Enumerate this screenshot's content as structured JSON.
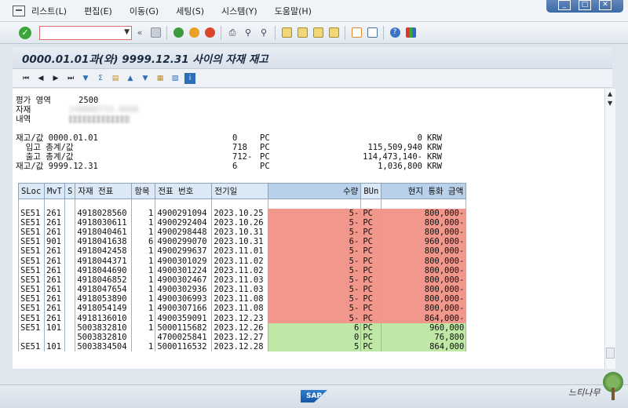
{
  "menu": {
    "items": [
      "리스트(L)",
      "편집(E)",
      "이동(G)",
      "세팅(S)",
      "시스템(Y)",
      "도움말(H)"
    ]
  },
  "window_controls": [
    "_",
    "□",
    "✕"
  ],
  "toolbar": {
    "command_value": ""
  },
  "title": "0000.01.01과(와) 9999.12.31 사이의 자재 재고",
  "header": {
    "area_label": "평가 영역",
    "area_value": "2500",
    "material_label": "자재",
    "material_value": "240000715.0000",
    "desc_label": "내역"
  },
  "summary": [
    {
      "label": "재고/값 0000.01.01",
      "qty": "0",
      "unit": "PC",
      "amount": "0",
      "currency": "KRW"
    },
    {
      "label": "  입고 총계/값",
      "qty": "718",
      "unit": "PC",
      "amount": "115,509,940",
      "currency": "KRW"
    },
    {
      "label": "  출고 총계/값",
      "qty": "712-",
      "unit": "PC",
      "amount": "114,473,140-",
      "currency": "KRW"
    },
    {
      "label": "재고/값 9999.12.31",
      "qty": "6",
      "unit": "PC",
      "amount": "1,036,800",
      "currency": "KRW"
    }
  ],
  "table": {
    "columns": [
      "SLoc",
      "MvT",
      "S",
      "자재 전표",
      "항목",
      "전표 번호",
      "전기일",
      "수량",
      "BUn",
      "현지 통화 금액"
    ],
    "rows": [
      {
        "sloc": "SE51",
        "mvt": "261",
        "s": "",
        "doc": "4918028560",
        "item": "1",
        "ref": "4900291094",
        "date": "2023.10.25",
        "qty": "5-",
        "bun": "PC",
        "amt": "800,000-",
        "type": "neg"
      },
      {
        "sloc": "SE51",
        "mvt": "261",
        "s": "",
        "doc": "4918030611",
        "item": "1",
        "ref": "4900292404",
        "date": "2023.10.26",
        "qty": "5-",
        "bun": "PC",
        "amt": "800,000-",
        "type": "neg"
      },
      {
        "sloc": "SE51",
        "mvt": "261",
        "s": "",
        "doc": "4918040461",
        "item": "1",
        "ref": "4900298448",
        "date": "2023.10.31",
        "qty": "5-",
        "bun": "PC",
        "amt": "800,000-",
        "type": "neg"
      },
      {
        "sloc": "SE51",
        "mvt": "901",
        "s": "",
        "doc": "4918041638",
        "item": "6",
        "ref": "4900299070",
        "date": "2023.10.31",
        "qty": "6-",
        "bun": "PC",
        "amt": "960,000-",
        "type": "neg"
      },
      {
        "sloc": "SE51",
        "mvt": "261",
        "s": "",
        "doc": "4918042458",
        "item": "1",
        "ref": "4900299637",
        "date": "2023.11.01",
        "qty": "5-",
        "bun": "PC",
        "amt": "800,000-",
        "type": "neg"
      },
      {
        "sloc": "SE51",
        "mvt": "261",
        "s": "",
        "doc": "4918044371",
        "item": "1",
        "ref": "4900301029",
        "date": "2023.11.02",
        "qty": "5-",
        "bun": "PC",
        "amt": "800,000-",
        "type": "neg"
      },
      {
        "sloc": "SE51",
        "mvt": "261",
        "s": "",
        "doc": "4918044690",
        "item": "1",
        "ref": "4900301224",
        "date": "2023.11.02",
        "qty": "5-",
        "bun": "PC",
        "amt": "800,000-",
        "type": "neg"
      },
      {
        "sloc": "SE51",
        "mvt": "261",
        "s": "",
        "doc": "4918046852",
        "item": "1",
        "ref": "4900302467",
        "date": "2023.11.03",
        "qty": "5-",
        "bun": "PC",
        "amt": "800,000-",
        "type": "neg"
      },
      {
        "sloc": "SE51",
        "mvt": "261",
        "s": "",
        "doc": "4918047654",
        "item": "1",
        "ref": "4900302936",
        "date": "2023.11.03",
        "qty": "5-",
        "bun": "PC",
        "amt": "800,000-",
        "type": "neg"
      },
      {
        "sloc": "SE51",
        "mvt": "261",
        "s": "",
        "doc": "4918053890",
        "item": "1",
        "ref": "4900306993",
        "date": "2023.11.08",
        "qty": "5-",
        "bun": "PC",
        "amt": "800,000-",
        "type": "neg"
      },
      {
        "sloc": "SE51",
        "mvt": "261",
        "s": "",
        "doc": "4918054149",
        "item": "1",
        "ref": "4900307166",
        "date": "2023.11.08",
        "qty": "5-",
        "bun": "PC",
        "amt": "800,000-",
        "type": "neg"
      },
      {
        "sloc": "SE51",
        "mvt": "261",
        "s": "",
        "doc": "4918136010",
        "item": "1",
        "ref": "4900359091",
        "date": "2023.12.23",
        "qty": "5-",
        "bun": "PC",
        "amt": "864,000-",
        "type": "neg"
      },
      {
        "sloc": "SE51",
        "mvt": "101",
        "s": "",
        "doc": "5003832810",
        "item": "1",
        "ref": "5000115682",
        "date": "2023.12.26",
        "qty": "6",
        "bun": "PC",
        "amt": "960,000",
        "type": "pos"
      },
      {
        "sloc": "",
        "mvt": "",
        "s": "",
        "doc": "5003832810",
        "item": "",
        "ref": "4700025841",
        "date": "2023.12.27",
        "qty": "0",
        "bun": "PC",
        "amt": "76,800",
        "type": "pos"
      },
      {
        "sloc": "SE51",
        "mvt": "101",
        "s": "",
        "doc": "5003834504",
        "item": "1",
        "ref": "5000116532",
        "date": "2023.12.28",
        "qty": "5",
        "bun": "PC",
        "amt": "864,000",
        "type": "pos"
      }
    ]
  },
  "status": {
    "logo": "SAP"
  },
  "watermark": "느티나무",
  "colors": {
    "negative_cell": "#f2978b",
    "positive_cell": "#bfe8a6",
    "header_key": "#b8d0ea"
  }
}
